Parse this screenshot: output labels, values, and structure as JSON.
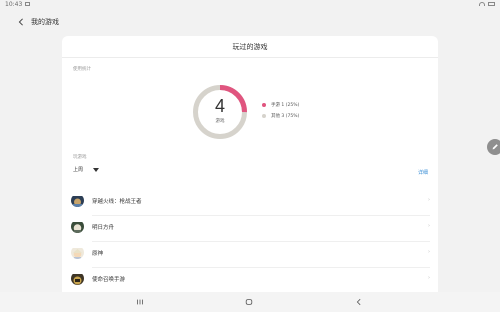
{
  "status_bar": {
    "time": "10:43"
  },
  "header": {
    "title": "我的游戏"
  },
  "card": {
    "title": "玩过的游戏",
    "chart_section_label": "使用统计",
    "list_section_label": "玩游戏"
  },
  "chart_data": {
    "type": "pie",
    "center_value": "4",
    "center_label": "游戏",
    "legend": [
      {
        "label": "手游 1 (25%)",
        "value": 1,
        "percent": 25,
        "color": "#e0557f"
      },
      {
        "label": "其他 3 (75%)",
        "value": 3,
        "percent": 75,
        "color": "#d6d3cc"
      }
    ]
  },
  "filter": {
    "selected": "上周",
    "details_link": "详细"
  },
  "games": [
    {
      "name": "穿越火线：枪战王者",
      "icon": "cf-game-icon"
    },
    {
      "name": "明日方舟",
      "icon": "arknights-game-icon"
    },
    {
      "name": "原神",
      "icon": "genshin-game-icon"
    },
    {
      "name": "使命召唤手游",
      "icon": "cod-game-icon"
    }
  ],
  "colors": {
    "accent_pink": "#e0557f",
    "ring_gray": "#d6d3cc",
    "link_blue": "#3b8fd6",
    "background": "#f2f2f2"
  }
}
